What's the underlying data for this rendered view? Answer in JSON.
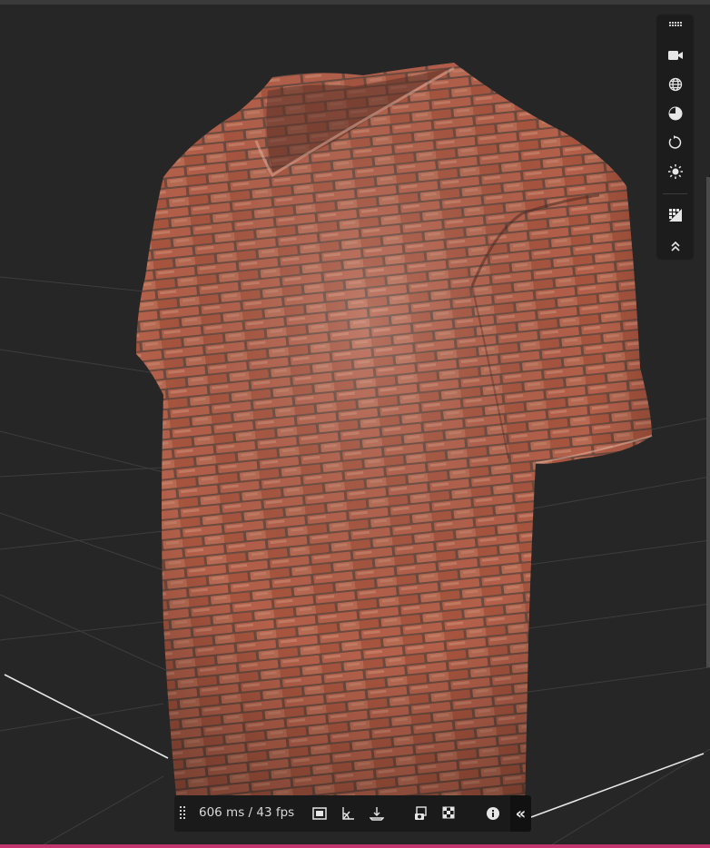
{
  "viewer": {
    "background_color": "#262626",
    "model": "t-shirt with red brick texture",
    "accent_color": "#c2386e"
  },
  "side_toolbar": {
    "items": [
      {
        "icon": "grip-icon"
      },
      {
        "icon": "camera-icon"
      },
      {
        "icon": "globe-icon"
      },
      {
        "icon": "material-sphere-icon"
      },
      {
        "icon": "rotate-icon"
      },
      {
        "icon": "light-icon"
      },
      {
        "icon": "gradient-icon"
      },
      {
        "icon": "chevrons-up-icon"
      }
    ]
  },
  "bottom_toolbar": {
    "stats": "606 ms / 43 fps",
    "buttons": [
      {
        "icon": "frame-icon"
      },
      {
        "icon": "angle-icon"
      },
      {
        "icon": "ground-icon"
      },
      {
        "icon": "screenshot-icon"
      },
      {
        "icon": "checker-icon"
      },
      {
        "icon": "info-icon"
      }
    ],
    "collapse_label": "«"
  }
}
